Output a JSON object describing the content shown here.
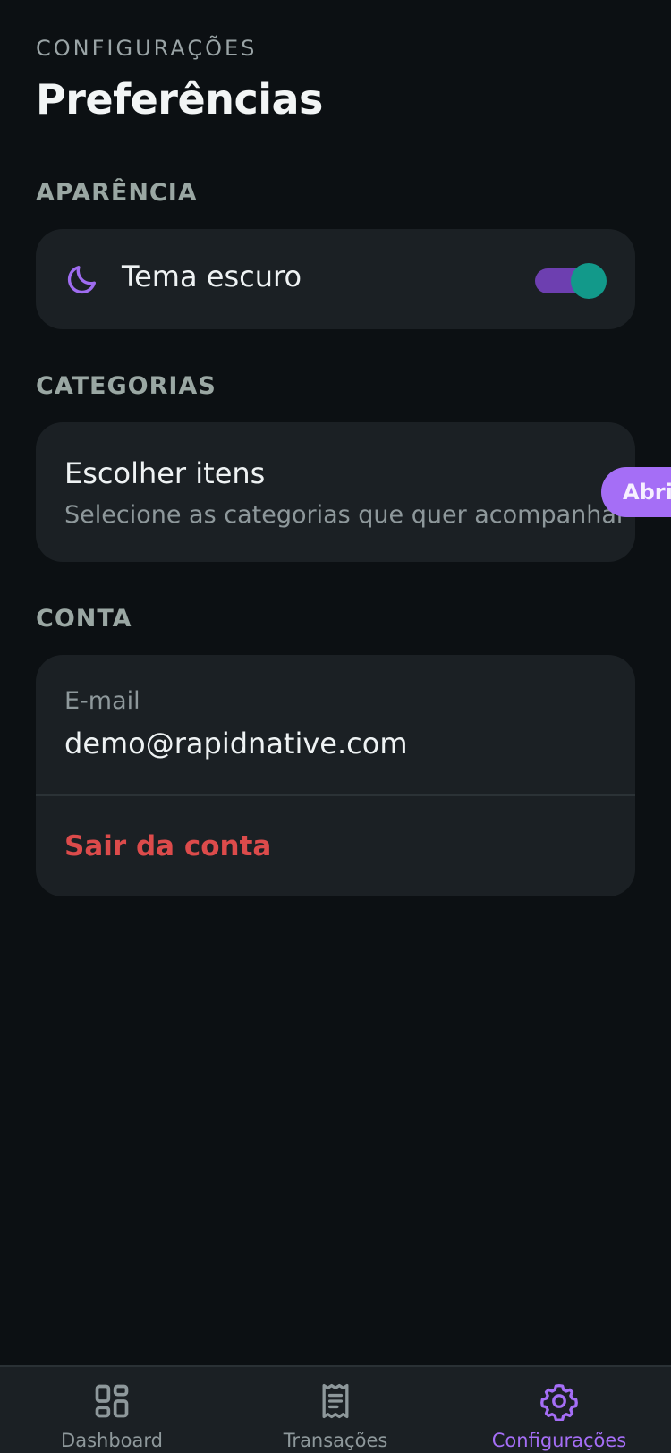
{
  "header": {
    "eyebrow": "CONFIGURAÇÕES",
    "title": "Preferências"
  },
  "appearance": {
    "section_title": "APARÊNCIA",
    "theme_label": "Tema escuro",
    "theme_icon": "moon-icon",
    "dark_theme_enabled": true
  },
  "categories": {
    "section_title": "CATEGORIAS",
    "label": "Escolher itens",
    "description": "Selecione as categorias que quer acompanhar",
    "open_button_label": "Abrir"
  },
  "account": {
    "section_title": "CONTA",
    "email_label": "E-mail",
    "email_value": "demo@rapidnative.com",
    "logout_label": "Sair da conta"
  },
  "tabs": [
    {
      "label": "Dashboard",
      "icon": "dashboard-icon",
      "active": false
    },
    {
      "label": "Transações",
      "icon": "receipt-icon",
      "active": false
    },
    {
      "label": "Configurações",
      "icon": "gear-icon",
      "active": true
    }
  ],
  "colors": {
    "background": "#0c1013",
    "card": "#1b2024",
    "accent": "#a56ef6",
    "toggle_track": "#6d3fb0",
    "toggle_knob": "#12998a",
    "danger": "#dc4b4b"
  }
}
